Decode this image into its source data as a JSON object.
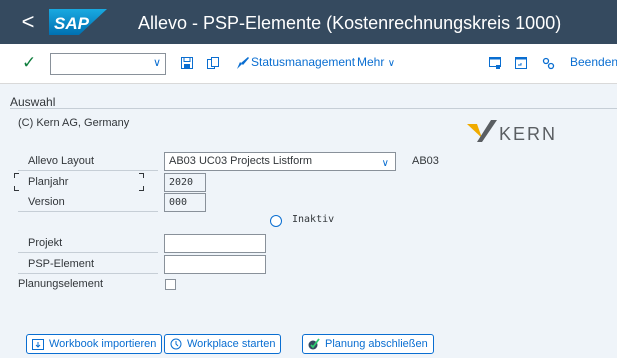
{
  "header": {
    "back_glyph": "<",
    "logo_text": "SAP",
    "title": "Allevo - PSP-Elemente (Kostenrechnungskreis 1000)"
  },
  "toolbar": {
    "check_glyph": "✓",
    "command_value": "",
    "status_label": "Statusmanagement",
    "more_label": "Mehr",
    "exit_label": "Beenden",
    "icons": [
      "save-icon",
      "copy-icon",
      "status-edit-icon",
      "screen-icon",
      "window-icon",
      "settings-icon"
    ]
  },
  "section": {
    "title": "Auswahl",
    "copyright": "(C) Kern AG, Germany",
    "logo_text": "KERN"
  },
  "fields": {
    "layout_label": "Allevo Layout",
    "layout_value": "AB03 UC03 Projects Listform",
    "layout_code": "AB03",
    "planjahr_label": "Planjahr",
    "planjahr_value": "2020",
    "version_label": "Version",
    "version_value": "000",
    "inaktiv_label": "Inaktiv",
    "projekt_label": "Projekt",
    "projekt_value": "",
    "psp_label": "PSP-Element",
    "psp_value": "",
    "planungselement_label": "Planungselement",
    "planungselement_checked": false
  },
  "buttons": {
    "import_label": "Workbook importieren",
    "workplace_label": "Workplace starten",
    "close_label": "Planung abschließen"
  },
  "colors": {
    "shell": "#354a5f",
    "accent": "#0a6ed1",
    "background": "#eff4f9",
    "success": "#107e3e",
    "kern_orange": "#f0ab00"
  }
}
